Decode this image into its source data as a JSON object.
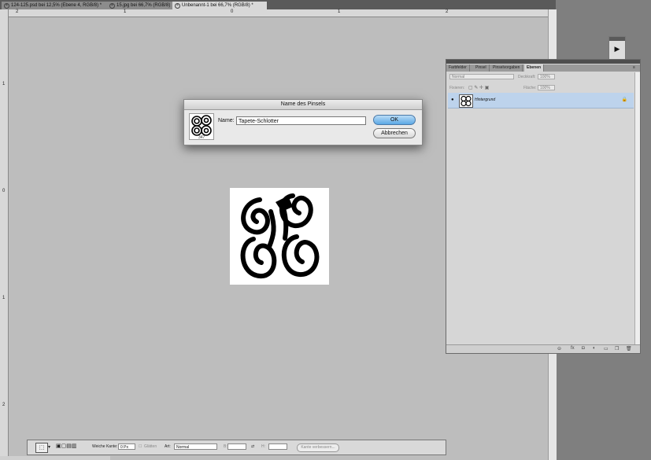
{
  "tabs": [
    {
      "label": "124-125.psd bei 12,5% (Ebene 4, RGB/8) *"
    },
    {
      "label": "15.jpg bei 66,7% (RGB/8)"
    },
    {
      "label": "Unbenannt-1 bei 66,7% (RGB/8) *"
    }
  ],
  "ruler": {
    "top": [
      "2",
      "1",
      "0",
      "1",
      "2"
    ],
    "left": [
      "1",
      "0",
      "1",
      "2"
    ]
  },
  "dialog": {
    "title": "Name des Pinsels",
    "brush_size": "347",
    "name_label": "Name:",
    "name_value": "Tapete-Schlotter",
    "ok_label": "OK",
    "cancel_label": "Abbrechen"
  },
  "panel": {
    "tabs": [
      "Farbfelder",
      "Pinsel",
      "Pinselvorgaben",
      "Ebenen"
    ],
    "active_tab": "Ebenen",
    "blend_mode": "Normal",
    "opacity_label": "Deckkraft:",
    "opacity_value": "100%",
    "lock_label": "Fixieren:",
    "fill_label": "Fläche:",
    "fill_value": "100%",
    "layer_name": "Hintergrund"
  },
  "options": {
    "feather_label": "Weiche Kante:",
    "feather_value": "0 Px",
    "smooth_label": "Glätten",
    "style_label": "Art:",
    "style_value": "Normal",
    "width_label": "B:",
    "height_label": "H:",
    "refine_label": "Kante verbessern..."
  },
  "colors": {
    "accent": "#5ba8e5",
    "layer_selected": "#bdd3ec"
  }
}
